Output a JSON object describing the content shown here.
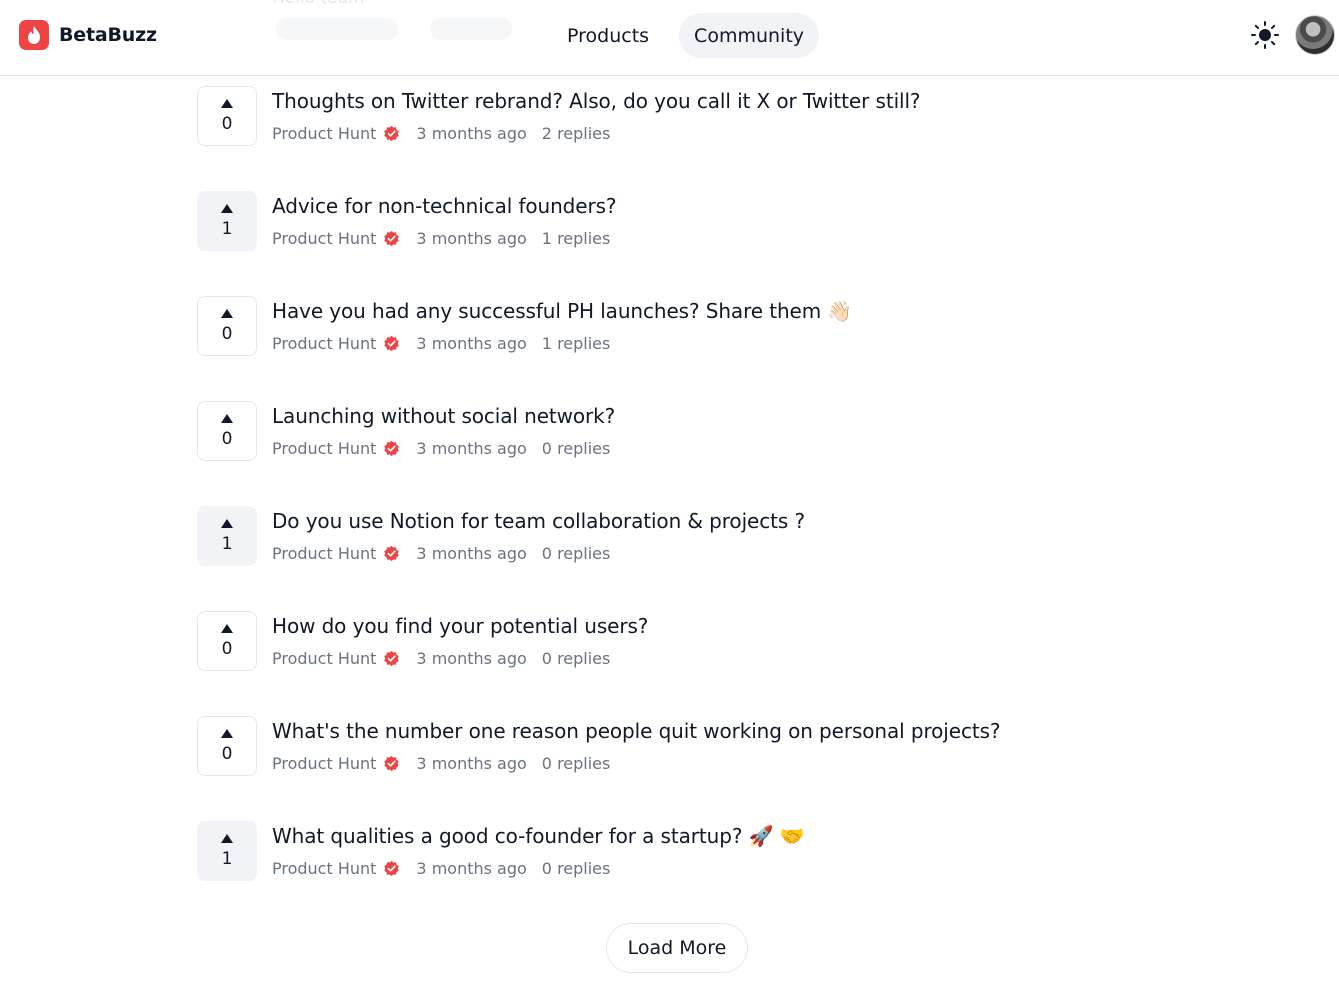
{
  "app": {
    "name": "BetaBuzz",
    "brand_color": "#ef4444"
  },
  "nav": {
    "tabs": [
      {
        "label": "Products",
        "active": false
      },
      {
        "label": "Community",
        "active": true
      }
    ]
  },
  "header": {
    "theme_icon": "sun-icon",
    "avatar_icon": "user-avatar"
  },
  "partial_top_item": {
    "title": "Hello team"
  },
  "discussions": [
    {
      "title": "Thoughts on Twitter rebrand? Also, do you call it X or Twitter still?",
      "votes": "0",
      "voted": false,
      "author": "Product Hunt",
      "time": "3 months ago",
      "replies": "2 replies"
    },
    {
      "title": "Advice for non-technical founders?",
      "votes": "1",
      "voted": true,
      "author": "Product Hunt",
      "time": "3 months ago",
      "replies": "1 replies"
    },
    {
      "title": "Have you had any successful PH launches? Share them 👋🏻",
      "votes": "0",
      "voted": false,
      "author": "Product Hunt",
      "time": "3 months ago",
      "replies": "1 replies"
    },
    {
      "title": "Launching without social network?",
      "votes": "0",
      "voted": false,
      "author": "Product Hunt",
      "time": "3 months ago",
      "replies": "0 replies"
    },
    {
      "title": "Do you use Notion for team collaboration & projects ?",
      "votes": "1",
      "voted": true,
      "author": "Product Hunt",
      "time": "3 months ago",
      "replies": "0 replies"
    },
    {
      "title": "How do you find your potential users?",
      "votes": "0",
      "voted": false,
      "author": "Product Hunt",
      "time": "3 months ago",
      "replies": "0 replies"
    },
    {
      "title": "What's the number one reason people quit working on personal projects?",
      "votes": "0",
      "voted": false,
      "author": "Product Hunt",
      "time": "3 months ago",
      "replies": "0 replies"
    },
    {
      "title": "What qualities a good co-founder for a startup? 🚀 🤝",
      "votes": "1",
      "voted": true,
      "author": "Product Hunt",
      "time": "3 months ago",
      "replies": "0 replies"
    }
  ],
  "verified_icon": "verified-badge-icon",
  "verified_color": "#ef4444",
  "upvote_icon": "upvote-arrow-icon",
  "load_more_label": "Load More"
}
